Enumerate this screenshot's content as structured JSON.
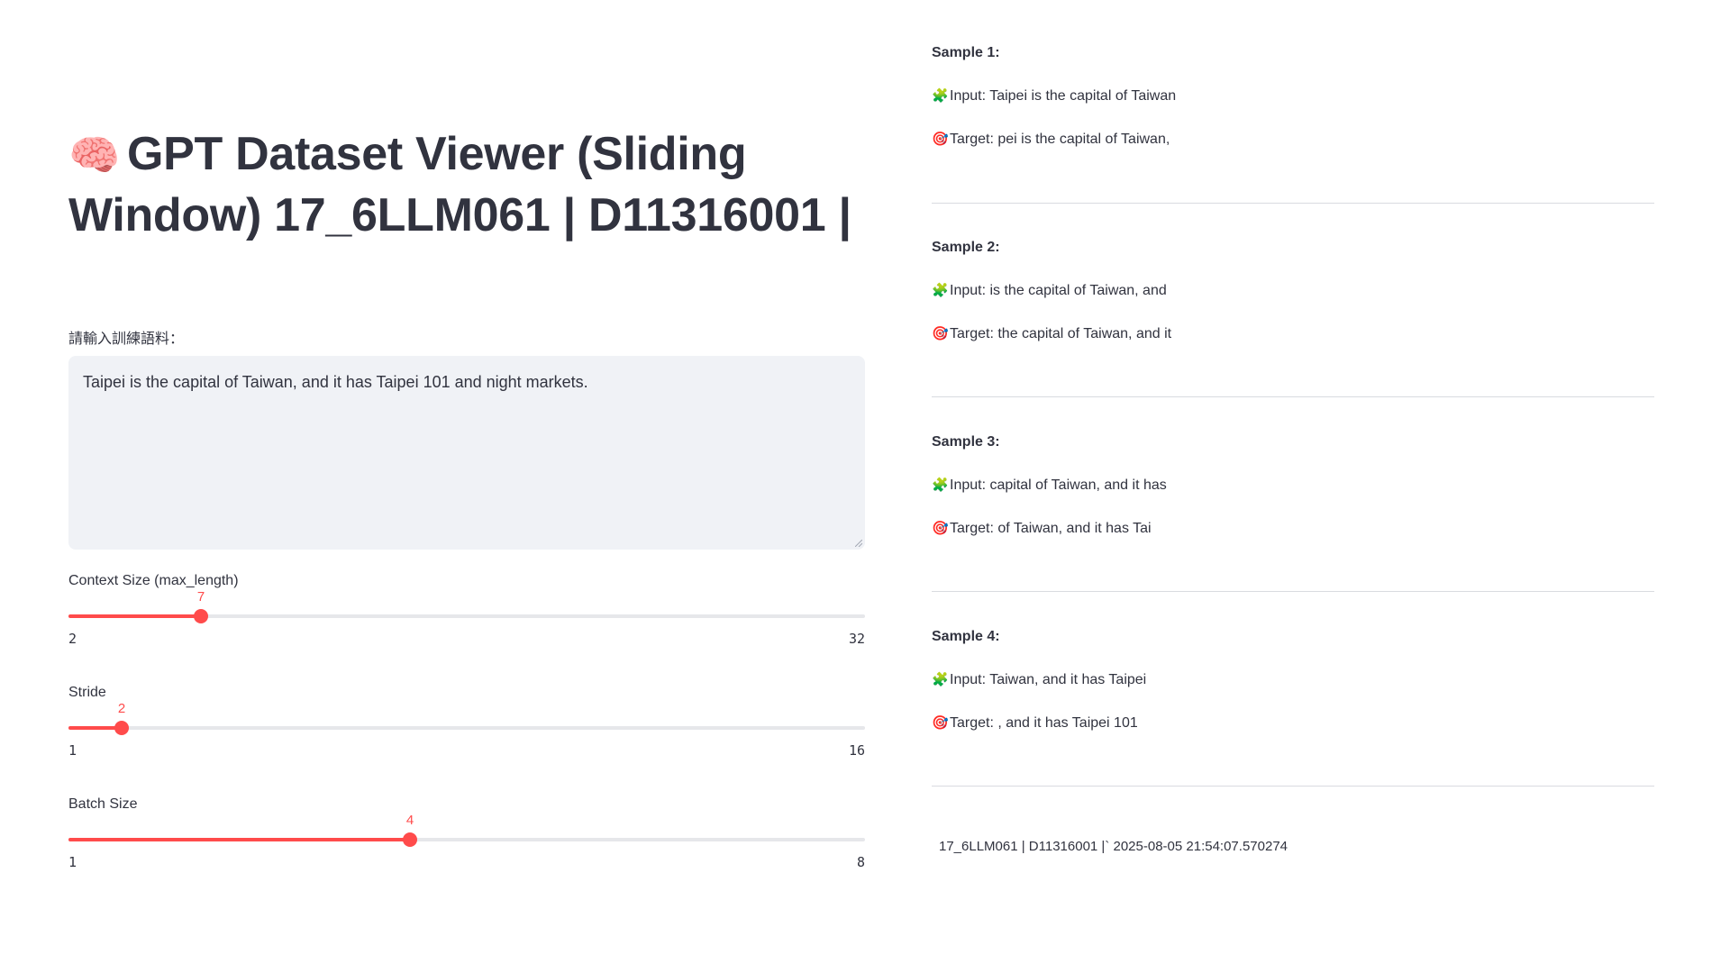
{
  "title": {
    "emoji": "🧠",
    "text": "GPT Dataset Viewer (Sliding Window) 17_6LLM061 | D11316001 |"
  },
  "textarea": {
    "label": "請輸入訓練語料：",
    "value": "Taipei is the capital of Taiwan, and it has Taipei 101 and night markets."
  },
  "sliders": [
    {
      "label": "Context Size (max_length)",
      "value": "7",
      "min": "2",
      "max": "32",
      "fraction": 0.1667
    },
    {
      "label": "Stride",
      "value": "2",
      "min": "1",
      "max": "16",
      "fraction": 0.0667
    },
    {
      "label": "Batch Size",
      "value": "4",
      "min": "1",
      "max": "8",
      "fraction": 0.4286
    }
  ],
  "samples": [
    {
      "title": "Sample 1:",
      "input": "Input: Taipei is the capital of Taiwan",
      "target": "Target: pei is the capital of Taiwan,"
    },
    {
      "title": "Sample 2:",
      "input": "Input: is the capital of Taiwan, and",
      "target": "Target: the capital of Taiwan, and it"
    },
    {
      "title": "Sample 3:",
      "input": "Input: capital of Taiwan, and it has",
      "target": "Target: of Taiwan, and it has Tai"
    },
    {
      "title": "Sample 4:",
      "input": "Input: Taiwan, and it has Taipei",
      "target": "Target: , and it has Taipei 101"
    }
  ],
  "icons": {
    "input": "🧩",
    "target": "🎯"
  },
  "footer": "17_6LLM061 | D11316001 |` 2025-08-05 21:54:07.570274",
  "colors": {
    "accent": "#ff4b4b",
    "text": "#31333f",
    "textarea_bg": "#f0f2f6",
    "track": "#e6e7ea"
  }
}
